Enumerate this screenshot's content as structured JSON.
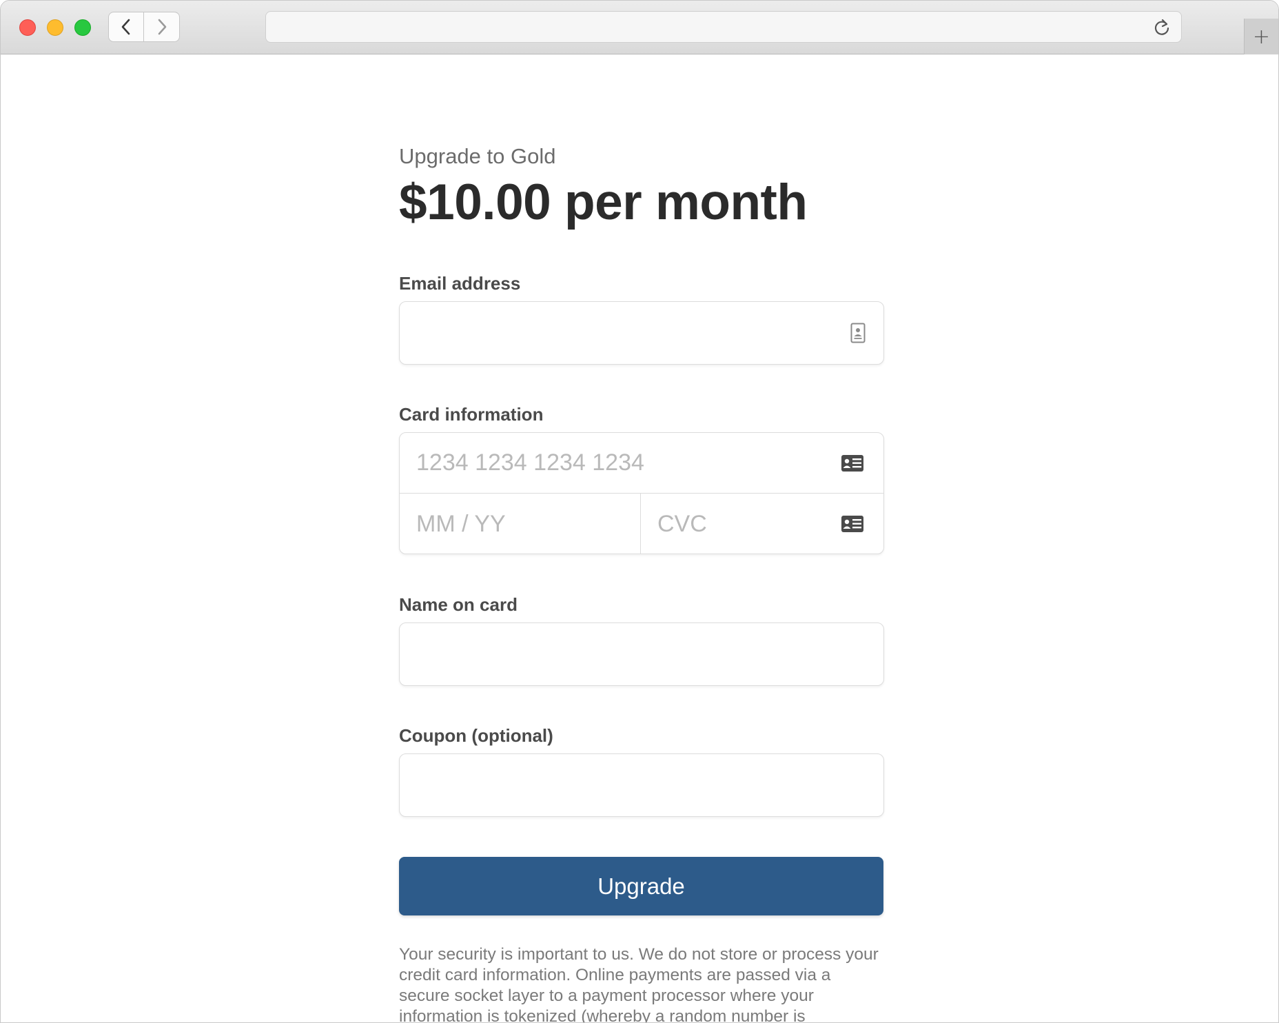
{
  "browser": {
    "url": "",
    "icons": {
      "close": "close-traffic-light",
      "minimize": "minimize-traffic-light",
      "maximize": "maximize-traffic-light",
      "back": "chevron-left-icon",
      "forward": "chevron-right-icon",
      "reload": "reload-icon",
      "new_tab": "plus-icon"
    },
    "new_tab_label": "+"
  },
  "checkout": {
    "eyebrow": "Upgrade to Gold",
    "price": "$10.00 per month",
    "email": {
      "label": "Email address",
      "value": "",
      "placeholder": ""
    },
    "card": {
      "label": "Card information",
      "number_placeholder": "1234 1234 1234 1234",
      "expiry_placeholder": "MM / YY",
      "cvc_placeholder": "CVC"
    },
    "name": {
      "label": "Name on card",
      "value": "",
      "placeholder": ""
    },
    "coupon": {
      "label": "Coupon (optional)",
      "value": "",
      "placeholder": ""
    },
    "submit_label": "Upgrade",
    "security_note": "Your security is important to us. We do not store or process your credit card information. Online payments are passed via a secure socket layer to a payment processor where your information is tokenized (whereby a random number is"
  },
  "colors": {
    "button": "#2d5b8a",
    "button_text": "#ffffff",
    "heading": "#2b2b2b",
    "muted": "#6b6b6b"
  }
}
